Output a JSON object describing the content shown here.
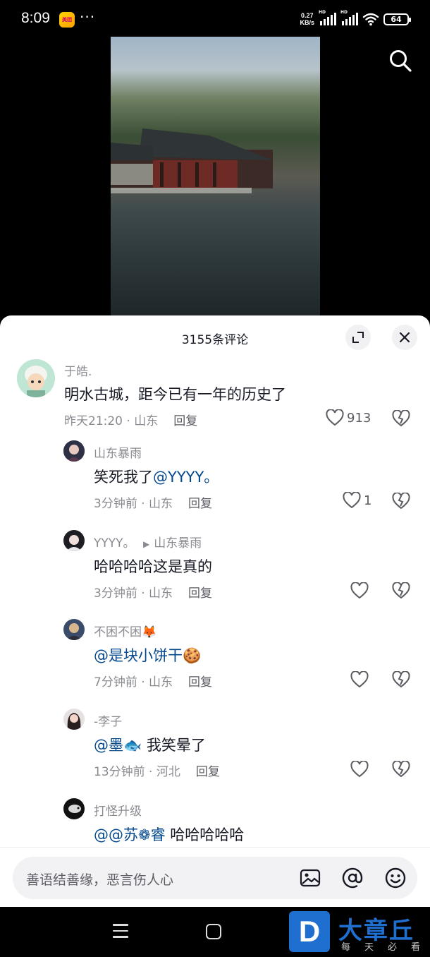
{
  "status_bar": {
    "time": "8:09",
    "app_icon_label": "美团",
    "dots": "···",
    "net_speed_value": "0.27",
    "net_speed_unit": "KB/s",
    "signal_label": "HD",
    "battery": "64"
  },
  "sheet": {
    "title": "3155条评论"
  },
  "comments": [
    {
      "username": "于皓.",
      "text": "明水古城，距今已有一年的历史了",
      "meta": "昨天21:20 · 山东",
      "reply": "回复",
      "likes": "913"
    },
    {
      "username": "山东暴雨",
      "text": "笑死我了",
      "mention": "@YYYY。",
      "meta": "3分钟前 · 山东",
      "reply": "回复",
      "likes": "1"
    },
    {
      "username": "YYYY。",
      "reply_to": "山东暴雨",
      "text": "哈哈哈哈这是真的",
      "meta": "3分钟前 · 山东",
      "reply": "回复"
    },
    {
      "username": "不困不困🦊",
      "mention": "@是块小饼干🍪",
      "meta": "7分钟前 · 山东",
      "reply": "回复"
    },
    {
      "username": "-李子",
      "mention": "@墨🐟",
      "text": " 我笑晕了",
      "meta": "13分钟前 · 河北",
      "reply": "回复"
    },
    {
      "username": "打怪升级",
      "mention": "@@苏❁睿",
      "text": " 哈哈哈哈哈"
    }
  ],
  "input": {
    "placeholder": "善语结善缘，恶言伤人心"
  },
  "watermark": {
    "logo": "D",
    "title": "大章丘",
    "subtitle": "每天必看"
  },
  "colors": {
    "mention": "#04498d",
    "muted": "#8a8b91",
    "text": "#161823",
    "watermark_blue": "#1f6fd1"
  }
}
